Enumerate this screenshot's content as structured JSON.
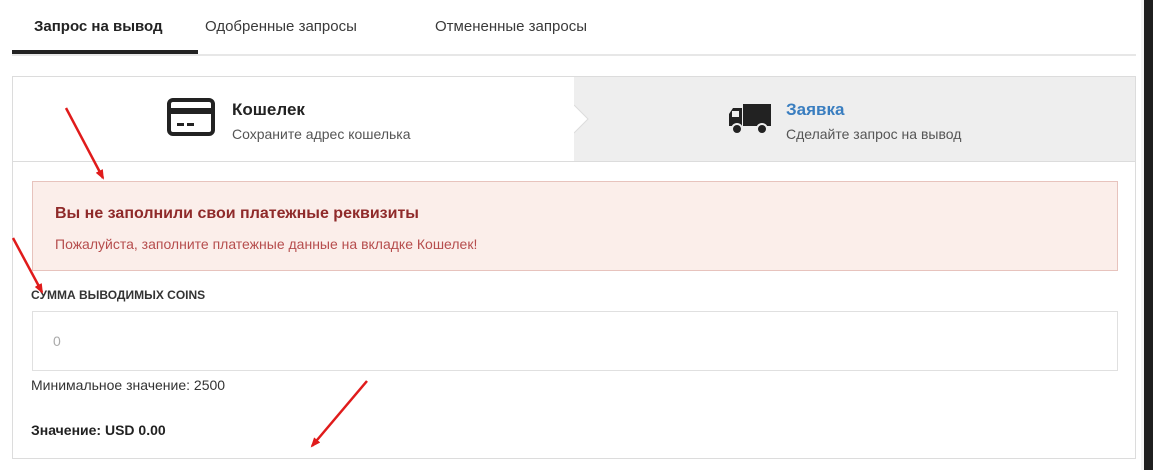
{
  "tabs": [
    {
      "label": "Запрос на вывод",
      "active": true
    },
    {
      "label": "Одобренные запросы",
      "active": false
    },
    {
      "label": "Отмененные запросы",
      "active": false
    }
  ],
  "steps": [
    {
      "title": "Кошелек",
      "subtitle": "Сохраните адрес кошелька",
      "icon": "credit-card-icon",
      "active": false
    },
    {
      "title": "Заявка",
      "subtitle": "Сделайте запрос на вывод",
      "icon": "truck-icon",
      "active": true
    }
  ],
  "alert": {
    "title": "Вы не заполнили свои платежные реквизиты",
    "message": "Пожалуйста, заполните платежные данные на вкладке Кошелек!"
  },
  "amount": {
    "label": "СУММА ВЫВОДИМЫХ COINS",
    "placeholder": "0",
    "value": ""
  },
  "min_value_text": "Минимальное значение: 2500",
  "value_text": "Значение: USD 0.00",
  "colors": {
    "accent": "#3a7ec0",
    "alert_bg": "#fbeeea",
    "alert_border": "#e7c3bd",
    "alert_title": "#8f2a2a",
    "alert_text": "#b64d4d",
    "annotation_arrow": "#e01b1b"
  }
}
